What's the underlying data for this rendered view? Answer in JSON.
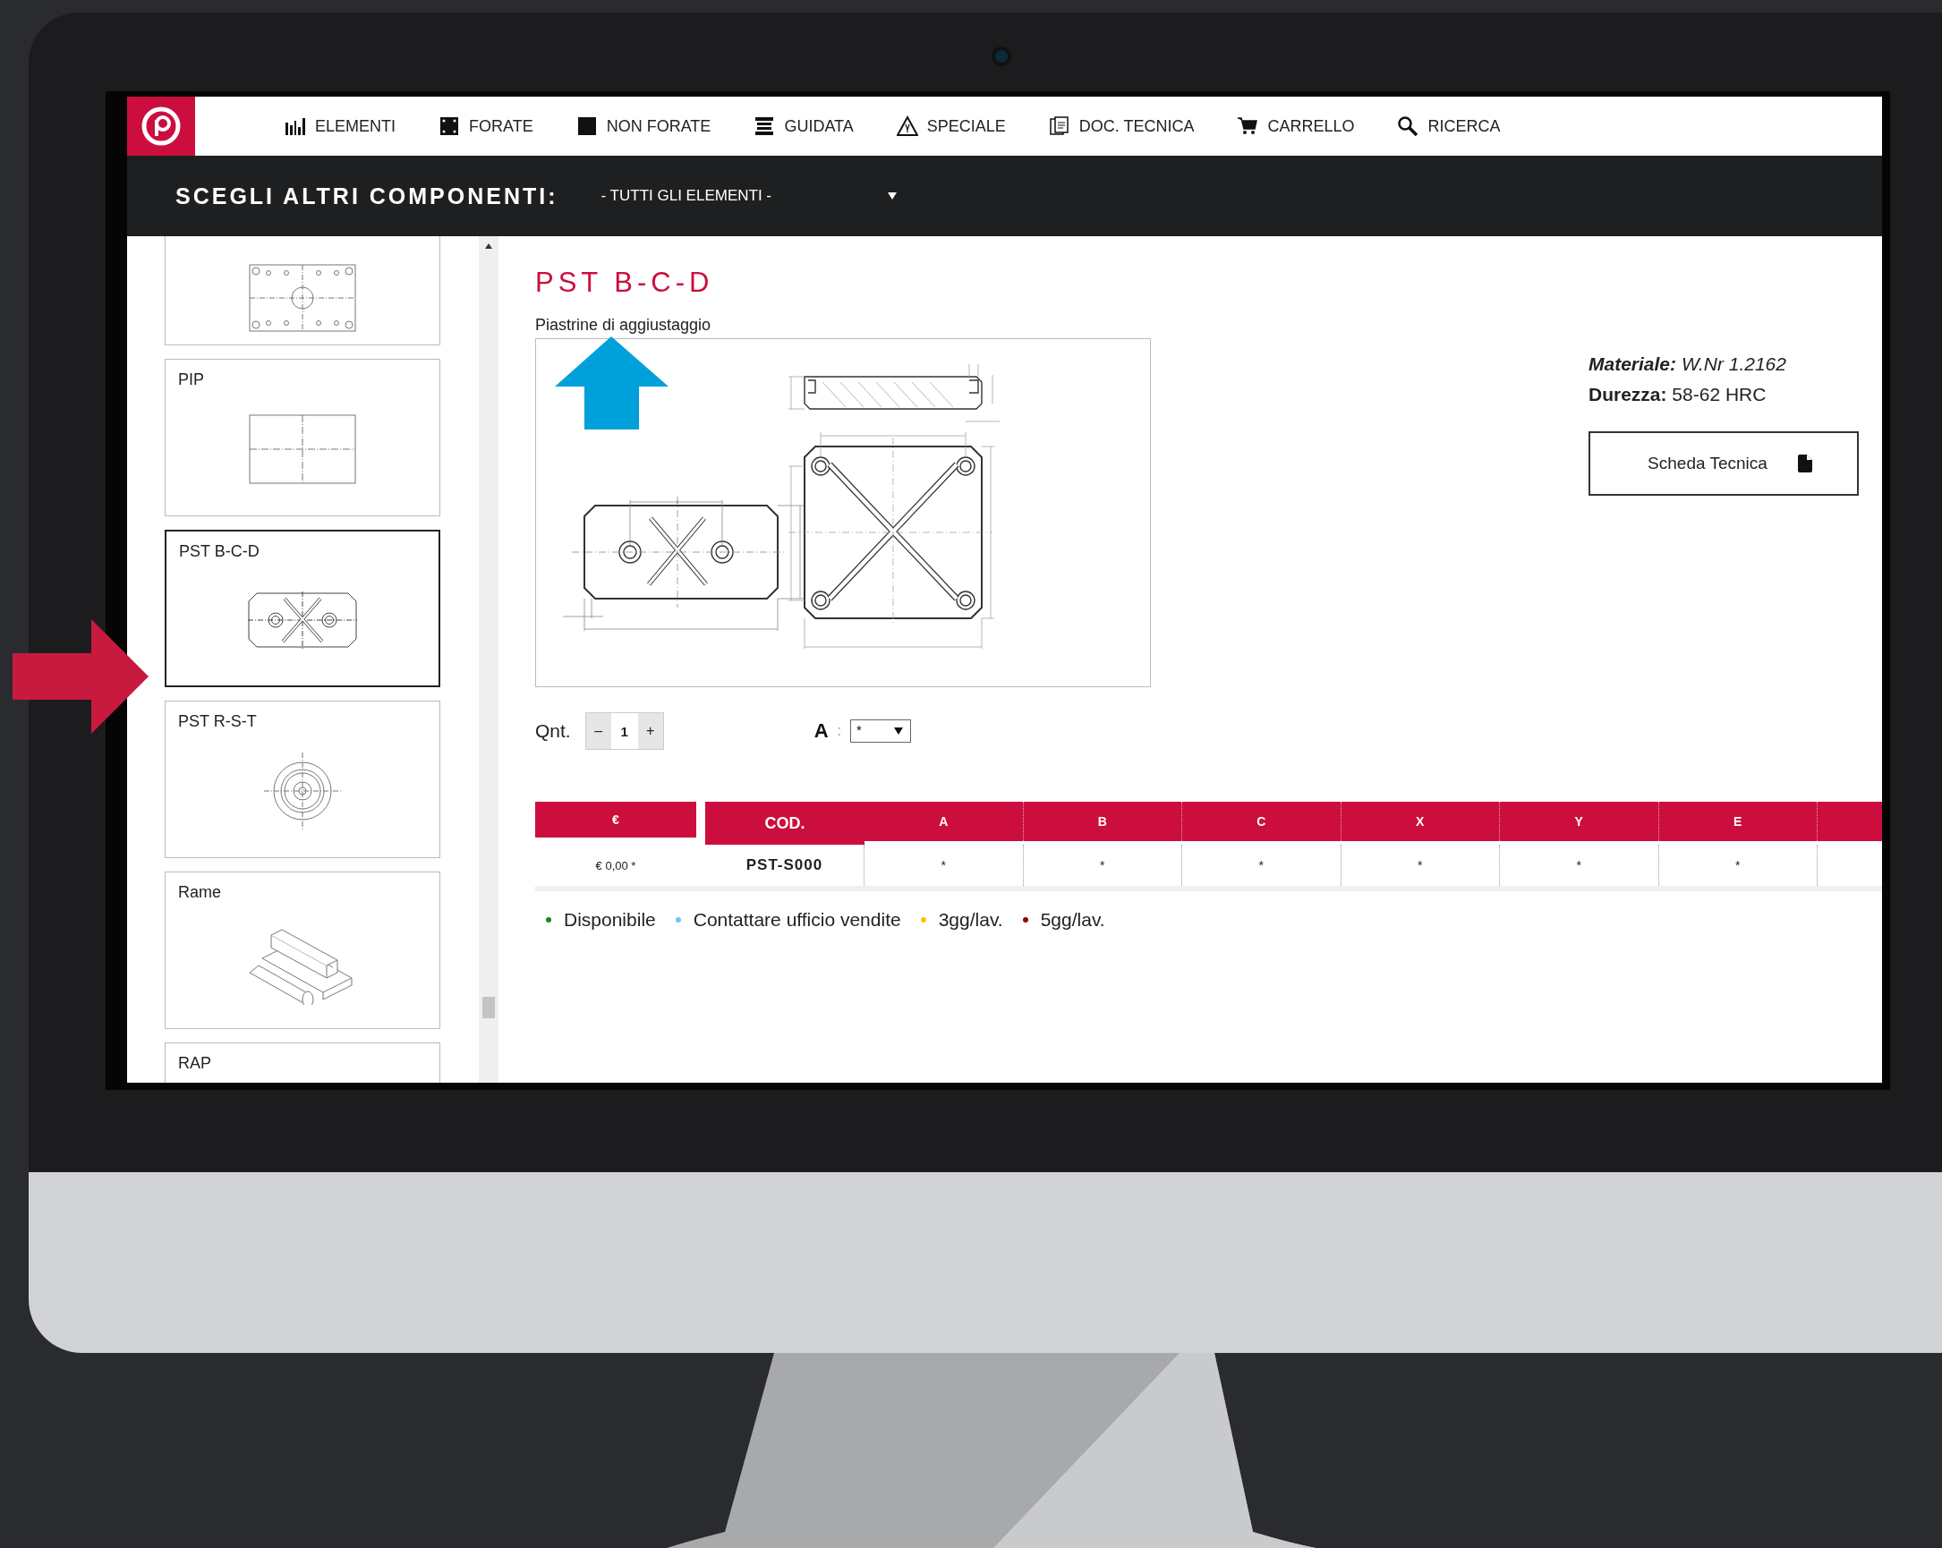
{
  "nav": {
    "items": [
      {
        "label": "ELEMENTI"
      },
      {
        "label": "FORATE"
      },
      {
        "label": "NON FORATE"
      },
      {
        "label": "GUIDATA"
      },
      {
        "label": "SPECIALE"
      },
      {
        "label": "DOC. TECNICA"
      },
      {
        "label": "CARRELLO"
      },
      {
        "label": "RICERCA"
      }
    ]
  },
  "filter_bar": {
    "label": "SCEGLI ALTRI COMPONENTI:",
    "dropdown": {
      "value": "- TUTTI GLI ELEMENTI -"
    }
  },
  "sidebar": {
    "items": [
      {
        "selected": false
      },
      {
        "label": "PIP",
        "selected": false
      },
      {
        "label": "PST B-C-D",
        "selected": true
      },
      {
        "label": "PST R-S-T",
        "selected": false
      },
      {
        "label": "Rame",
        "selected": false
      },
      {
        "label": "RAP",
        "selected": false
      }
    ]
  },
  "product": {
    "title": "PST B-C-D",
    "subtitle": "Piastrine di aggiustaggio",
    "specs": [
      {
        "label": "Materiale:",
        "value": "W.Nr 1.2162",
        "kind": "italic"
      },
      {
        "label": "Durezza:",
        "value": "58-62 HRC",
        "kind": "plain"
      }
    ],
    "datasheet_button": "Scheda Tecnica"
  },
  "quantity": {
    "label": "Qnt.",
    "decrement": "–",
    "value": "1",
    "increment": "+"
  },
  "filter": {
    "label": "A",
    "separator": ":",
    "value": "*"
  },
  "table": {
    "columns": [
      "€",
      "COD.",
      "A",
      "B",
      "C",
      "X",
      "Y",
      "E"
    ],
    "rows": [
      [
        "€ 0,00 *",
        "PST-S000",
        "*",
        "*",
        "*",
        "*",
        "*",
        "*"
      ]
    ]
  },
  "legend": [
    {
      "label": "Disponibile",
      "color": "#178a17"
    },
    {
      "label": "Contattare ufficio vendite",
      "color": "#6ec6f0"
    },
    {
      "label": "3gg/lav.",
      "color": "#f5c400"
    },
    {
      "label": "5gg/lav.",
      "color": "#8b0a0a"
    }
  ]
}
